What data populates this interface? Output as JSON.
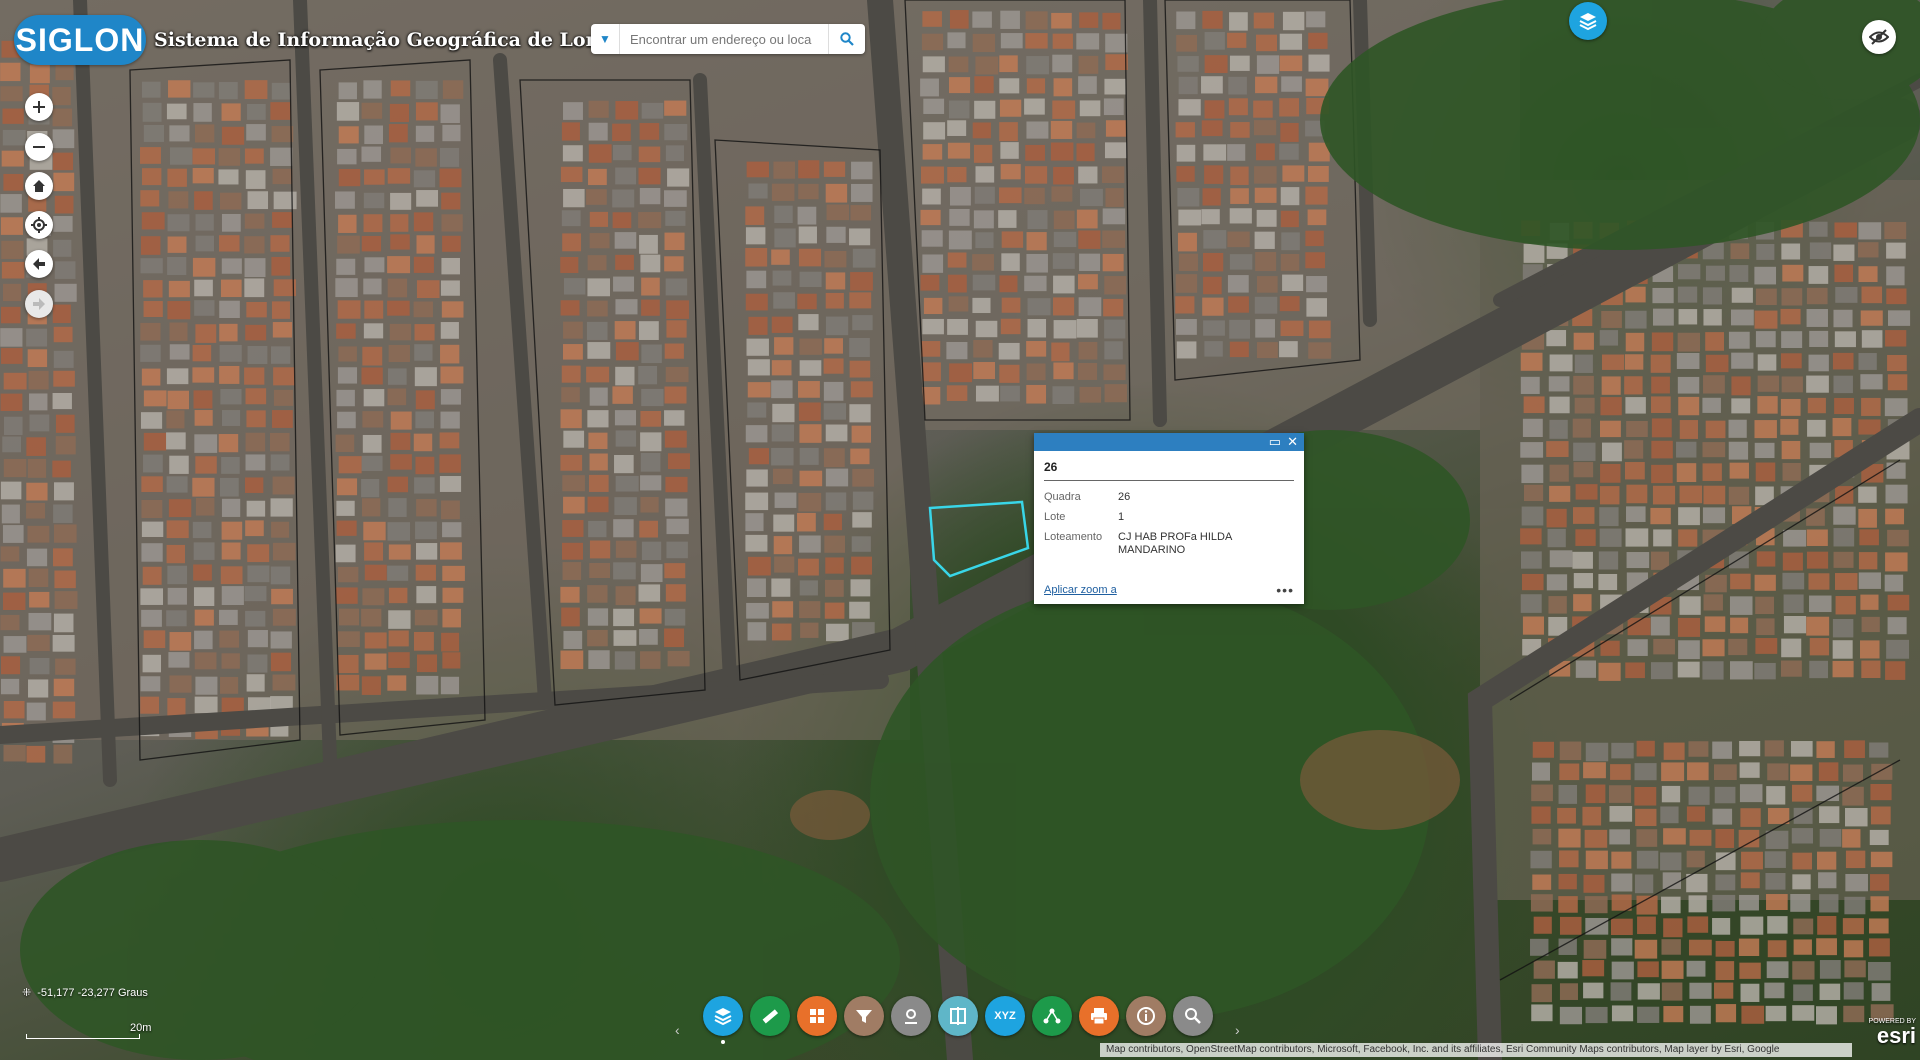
{
  "header": {
    "logo_text": "SIGLON",
    "title": "Sistema de Informação Geográfica de Londrina"
  },
  "search": {
    "placeholder": "Encontrar um endereço ou loca",
    "dropdown_icon": "caret-down-icon",
    "search_icon": "search-icon"
  },
  "map_controls": [
    {
      "name": "zoom-in-button",
      "icon": "+"
    },
    {
      "name": "zoom-out-button",
      "icon": "−"
    },
    {
      "name": "home-button",
      "icon": "home-icon"
    },
    {
      "name": "locate-button",
      "icon": "locate-icon"
    },
    {
      "name": "back-button",
      "icon": "arrow-left-icon"
    },
    {
      "name": "forward-button",
      "icon": "arrow-right-icon"
    }
  ],
  "popup": {
    "title": "26",
    "fields": [
      {
        "key": "Quadra",
        "value": "26"
      },
      {
        "key": "Lote",
        "value": "1"
      },
      {
        "key": "Loteamento",
        "value": "CJ HAB PROFa HILDA MANDARINO"
      }
    ],
    "zoom_link": "Aplicar zoom a",
    "more": "•••",
    "maximize_icon": "maximize-icon",
    "close_icon": "close-icon"
  },
  "coordinates": "-51,177 -23,277 Graus",
  "scale": "20m",
  "toolbar": {
    "buttons": [
      {
        "name": "layers-tool",
        "color": "#1ea4e0"
      },
      {
        "name": "measure-tool",
        "color": "#1d9a4a"
      },
      {
        "name": "basemap-tool",
        "color": "#e8702a"
      },
      {
        "name": "filter-tool",
        "color": "#a07c64"
      },
      {
        "name": "draw-tool",
        "color": "#8a8a8a"
      },
      {
        "name": "swipe-tool",
        "color": "#5fb6c8"
      },
      {
        "name": "coordinate-tool",
        "color": "#1ea4e0",
        "label": "XYZ"
      },
      {
        "name": "share-tool",
        "color": "#1d9a4a"
      },
      {
        "name": "print-tool",
        "color": "#e8702a"
      },
      {
        "name": "about-tool",
        "color": "#a07c64"
      },
      {
        "name": "query-tool",
        "color": "#8a8a8a"
      }
    ]
  },
  "attribution": "Map contributors, OpenStreetMap contributors, Microsoft, Facebook, Inc. and its affiliates, Esri Community Maps contributors, Map layer by Esri, Google",
  "esri": {
    "powered_by": "POWERED BY",
    "brand": "esri"
  },
  "colors": {
    "brand_blue": "#1f86c8",
    "popup_header": "#2d7fc0",
    "selection": "#39d6e8"
  }
}
